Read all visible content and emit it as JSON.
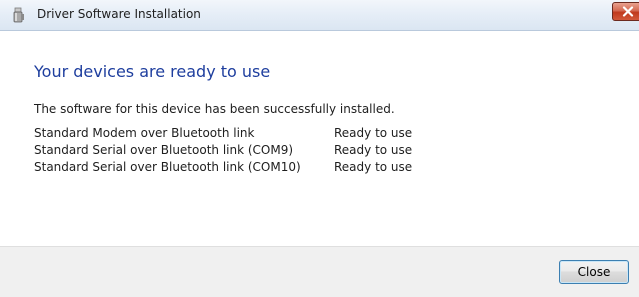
{
  "window": {
    "title": "Driver Software Installation",
    "icon": "usb-drive-icon",
    "close_glyph": "close-icon"
  },
  "content": {
    "heading": "Your devices are ready to use",
    "message": "The software for this device has been successfully installed.",
    "devices": [
      {
        "name": "Standard Modem over Bluetooth link",
        "status": "Ready to use"
      },
      {
        "name": "Standard Serial over Bluetooth link (COM9)",
        "status": "Ready to use"
      },
      {
        "name": "Standard Serial over Bluetooth link (COM10)",
        "status": "Ready to use"
      }
    ]
  },
  "footer": {
    "close_label": "Close"
  },
  "colors": {
    "heading": "#1e3e9e",
    "close_button_border": "#3c7fb1",
    "title_close_red": "#c0391d"
  }
}
